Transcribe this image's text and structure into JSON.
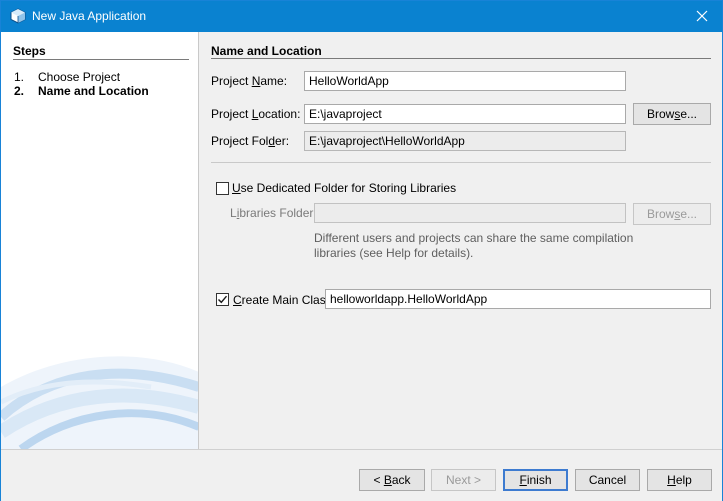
{
  "window": {
    "title": "New Java Application",
    "icon": "java-cube-icon",
    "close_icon": "close-icon"
  },
  "steps": {
    "title": "Steps",
    "items": [
      {
        "num": "1.",
        "label": "Choose Project"
      },
      {
        "num": "2.",
        "label": "Name and Location"
      }
    ]
  },
  "main": {
    "section_title": "Name and Location",
    "project_name": {
      "label_pre": "Project ",
      "label_u": "N",
      "label_post": "ame:",
      "value": "HelloWorldApp"
    },
    "project_location": {
      "label_pre": "Project ",
      "label_u": "L",
      "label_post": "ocation:",
      "value": "E:\\javaproject",
      "browse_label_u": "",
      "browse_label_pre": "Brow",
      "browse_label_ux": "s",
      "browse_label_post": "e..."
    },
    "project_folder": {
      "label_pre": "Project Fol",
      "label_u": "d",
      "label_post": "er:",
      "value": "E:\\javaproject\\HelloWorldApp"
    },
    "dedicated_folder": {
      "checked": false,
      "label_u": "U",
      "label_post": "se Dedicated Folder for Storing Libraries"
    },
    "libraries_folder": {
      "label_pre": "L",
      "label_u": "i",
      "label_post": "braries Folder:",
      "value": "",
      "browse_label_pre": "Brow",
      "browse_label_ux": "s",
      "browse_label_post": "e..."
    },
    "help_text_line1": "Different users and projects can share the same compilation",
    "help_text_line2": "libraries (see Help for details).",
    "create_main_class": {
      "checked": true,
      "label_u": "C",
      "label_post": "reate Main Class",
      "value": "helloworldapp.HelloWorldApp"
    }
  },
  "buttons": {
    "back": {
      "pre": "< ",
      "u": "B",
      "post": "ack"
    },
    "next": "Next >",
    "finish": {
      "u": "F",
      "post": "inish"
    },
    "cancel": "Cancel",
    "help": {
      "u": "H",
      "post": "elp"
    }
  },
  "colors": {
    "titlebar": "#0a82d0",
    "default_button_border": "#3d7bd0"
  }
}
